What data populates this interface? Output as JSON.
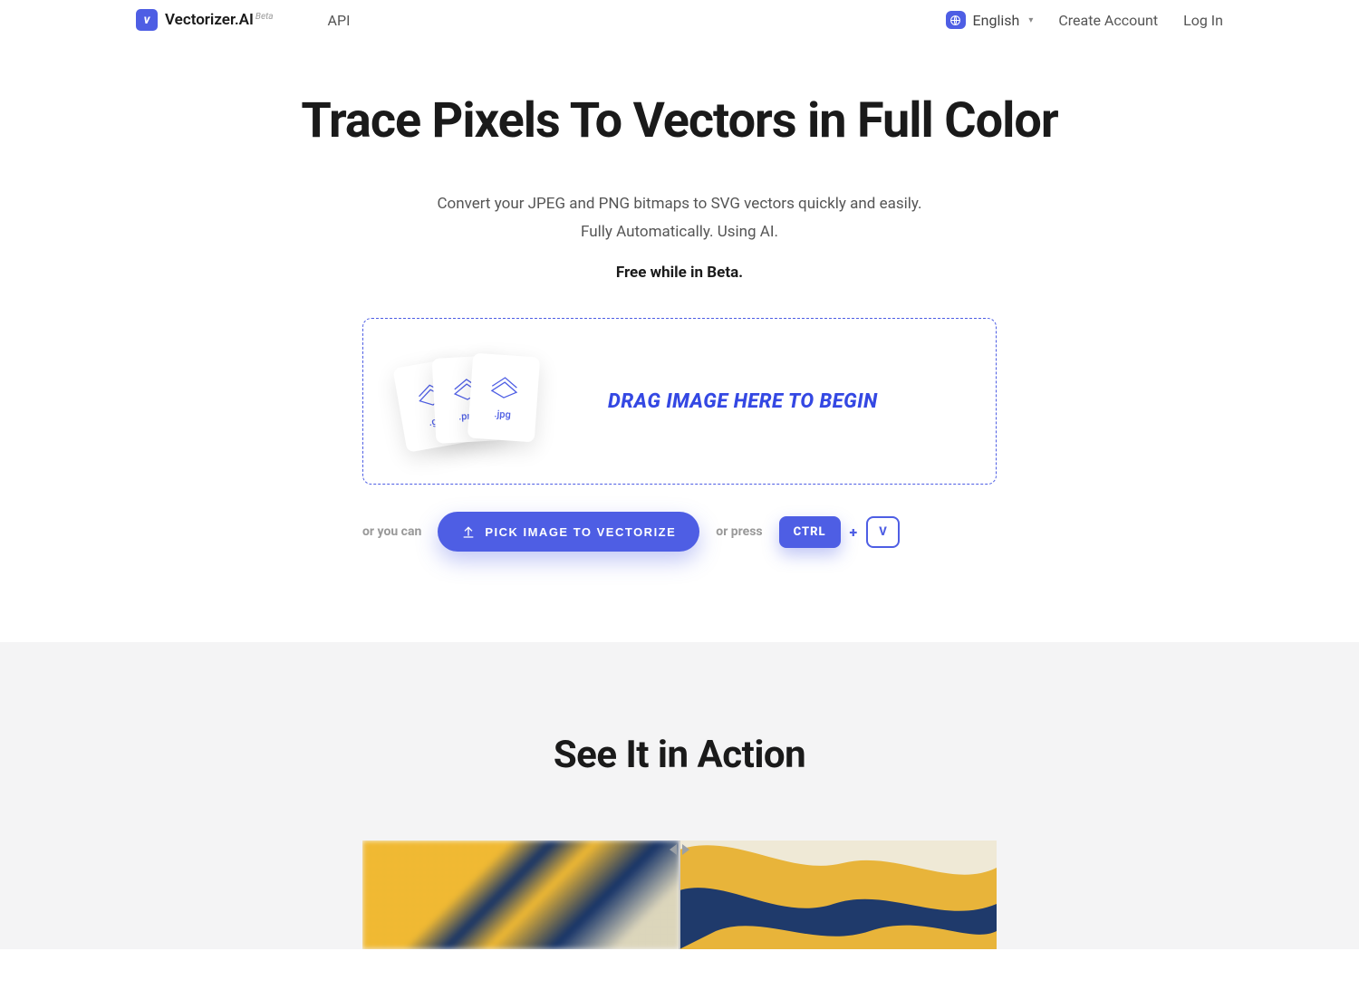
{
  "header": {
    "brand_name": "Vectorizer.AI",
    "brand_badge": "Beta",
    "nav_api": "API",
    "language": "English",
    "create_account": "Create Account",
    "log_in": "Log In"
  },
  "hero": {
    "title": "Trace Pixels To Vectors in Full Color",
    "sub_line1": "Convert your JPEG and PNG bitmaps to SVG vectors quickly and easily.",
    "sub_line2": "Fully Automatically. Using AI.",
    "beta_note": "Free while in Beta."
  },
  "dropzone": {
    "cta": "DRAG IMAGE HERE TO BEGIN",
    "ext_gif": ".gif",
    "ext_png": ".png",
    "ext_jpg": ".jpg"
  },
  "actions": {
    "or_you_can": "or you can",
    "pick_button": "PICK IMAGE TO VECTORIZE",
    "or_press": "or press",
    "key_ctrl": "CTRL",
    "key_plus": "+",
    "key_v": "V"
  },
  "section2": {
    "title": "See It in Action"
  }
}
